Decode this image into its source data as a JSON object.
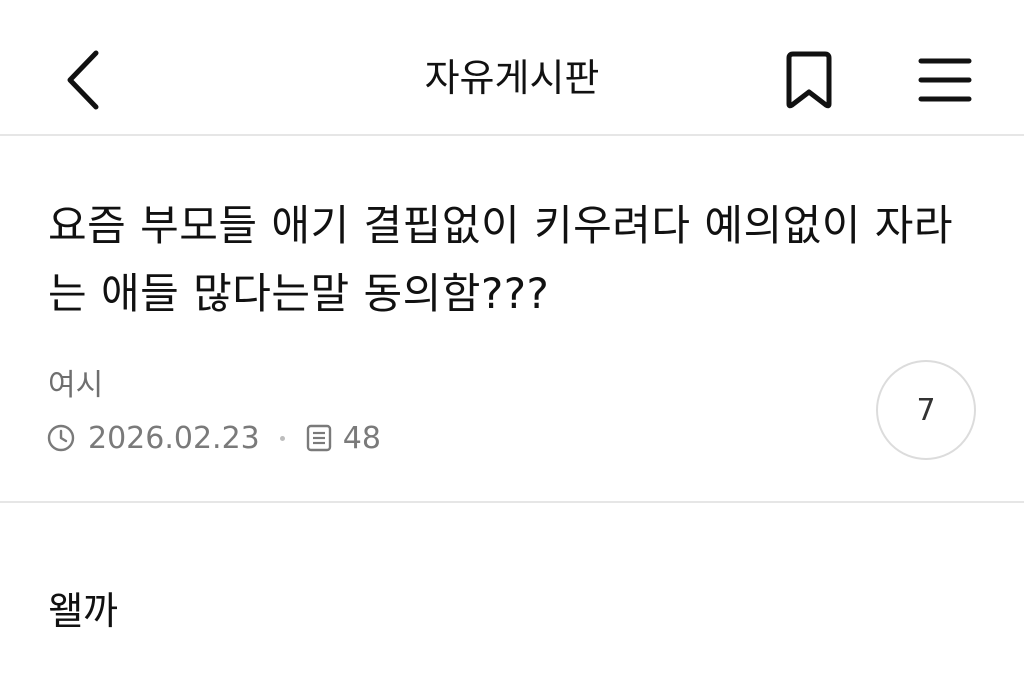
{
  "header": {
    "title": "자유게시판",
    "back_icon": "chevron-left-icon",
    "bookmark_icon": "bookmark-icon",
    "menu_icon": "hamburger-menu-icon"
  },
  "post": {
    "title": "요즘 부모들 애기 결핍없이 키우려다 예의없이 자라는 애들 많다는말 동의함???",
    "author": "여시",
    "date": "2026.02.23",
    "views": "48",
    "comment_count": "7",
    "body": "왤까"
  },
  "colors": {
    "text": "#111111",
    "meta": "#7a7a7a",
    "divider": "#e6e6e6",
    "circle_border": "#dcdcdc"
  }
}
